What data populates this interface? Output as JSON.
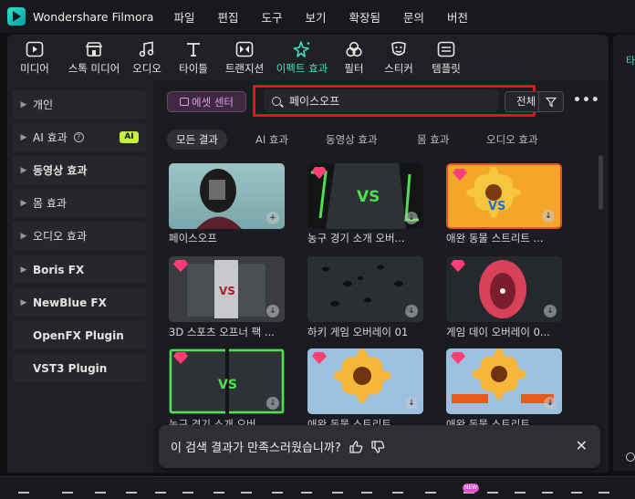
{
  "app": {
    "title": "Wondershare Filmora"
  },
  "menu": [
    "파일",
    "편집",
    "도구",
    "보기",
    "확장됨",
    "문의",
    "버전"
  ],
  "toolbar": [
    {
      "label": "미디어",
      "icon": "media-icon"
    },
    {
      "label": "스톡 미디어",
      "icon": "stock-media-icon"
    },
    {
      "label": "오디오",
      "icon": "music-note-icon"
    },
    {
      "label": "타이틀",
      "icon": "text-t-icon"
    },
    {
      "label": "트랜지션",
      "icon": "transition-icon"
    },
    {
      "label": "이펙트 효과",
      "icon": "sparkle-effects-icon",
      "active": true
    },
    {
      "label": "필터",
      "icon": "filter-circles-icon"
    },
    {
      "label": "스티커",
      "icon": "sticker-icon"
    },
    {
      "label": "템플릿",
      "icon": "template-icon"
    }
  ],
  "sidebar": [
    {
      "label": "개인",
      "chevron": true
    },
    {
      "label": "AI 효과",
      "chevron": true,
      "help": "?",
      "badge": "AI"
    },
    {
      "label": "동영상 효과",
      "chevron": true,
      "bold": true
    },
    {
      "label": "몸 효과",
      "chevron": true
    },
    {
      "label": "오디오 효과",
      "chevron": true
    },
    {
      "label": "Boris FX",
      "chevron": true
    },
    {
      "label": "NewBlue FX",
      "chevron": true
    },
    {
      "label": "OpenFX Plugin",
      "chevron": false
    },
    {
      "label": "VST3 Plugin",
      "chevron": false
    }
  ],
  "search": {
    "asset_center": "에셋 센터",
    "value": "페이스오프",
    "scope": "전체",
    "more": "•••"
  },
  "chips": [
    {
      "label": "모든 결과",
      "active": true
    },
    {
      "label": "AI 효과"
    },
    {
      "label": "동영상 효과"
    },
    {
      "label": "몸 효과"
    },
    {
      "label": "오디오 효과"
    }
  ],
  "results": [
    {
      "caption": "페이스오프",
      "premium": false,
      "action": "+"
    },
    {
      "caption": "농구 경기 소개 오버...",
      "premium": true,
      "action": "↓"
    },
    {
      "caption": "애완 동물 스트리트 ...",
      "premium": true,
      "action": "↓",
      "selected": true
    },
    {
      "caption": "3D 스포츠 오프너 팩 ...",
      "premium": true,
      "action": "↓"
    },
    {
      "caption": "하키 게임 오버레이 01",
      "premium": false,
      "action": "↓"
    },
    {
      "caption": "게임 데이 오버레이 0...",
      "premium": true,
      "action": "↓"
    },
    {
      "caption": "농구 경기 소개 오버...",
      "premium": true,
      "action": "↓"
    },
    {
      "caption": "애완 동물 스트리트 ...",
      "premium": true,
      "action": "↓"
    },
    {
      "caption": "애완 동물 스트리트 ...",
      "premium": true,
      "action": "↓"
    }
  ],
  "toast": {
    "message": "이 검색 결과가 만족스러웠습니까?"
  },
  "right_panel": {
    "tab_initial": "타"
  },
  "bottom": {
    "new_badge": "NEW"
  }
}
